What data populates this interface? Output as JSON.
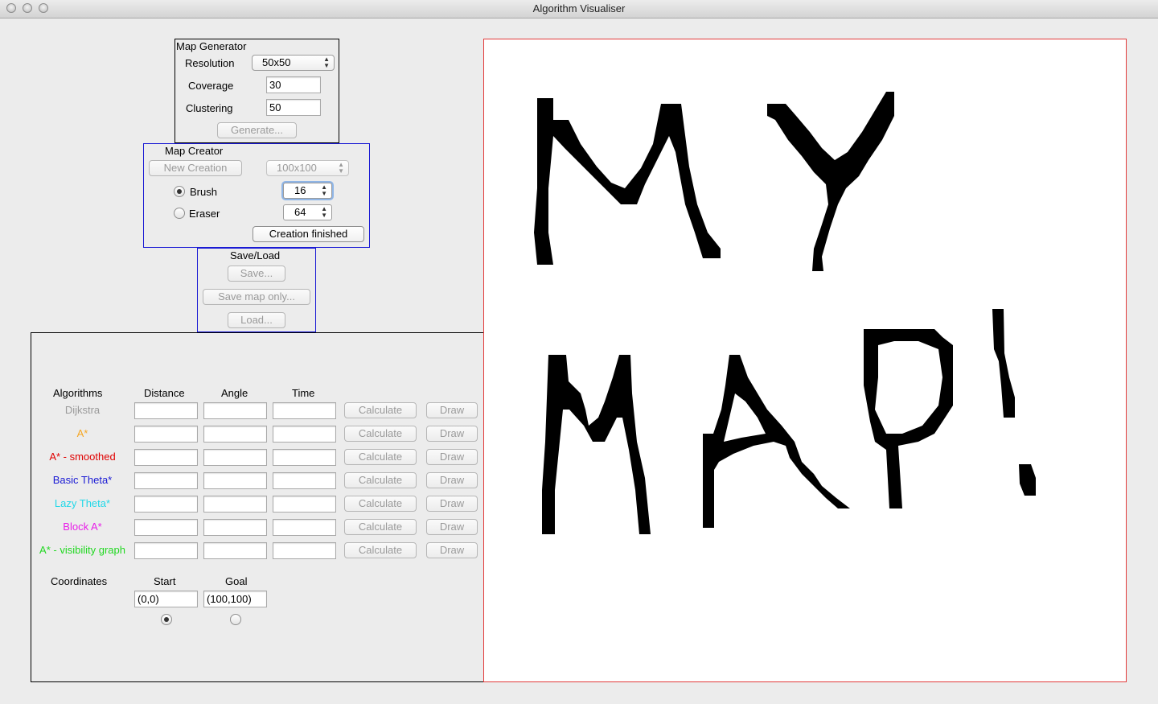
{
  "window": {
    "title": "Algorithm Visualiser"
  },
  "generator": {
    "title": "Map Generator",
    "resolution_label": "Resolution",
    "resolution_value": "50x50",
    "coverage_label": "Coverage",
    "coverage_value": "30",
    "clustering_label": "Clustering",
    "clustering_value": "50",
    "generate_label": "Generate..."
  },
  "creator": {
    "title": "Map Creator",
    "new_creation_label": "New Creation",
    "size_value": "100x100",
    "brush_label": "Brush",
    "brush_size": "16",
    "brush_selected": true,
    "eraser_label": "Eraser",
    "eraser_size": "64",
    "finished_label": "Creation finished"
  },
  "saveload": {
    "title": "Save/Load",
    "save_label": "Save...",
    "save_map_only_label": "Save map only...",
    "load_label": "Load..."
  },
  "algorithms": {
    "headers": {
      "algorithms": "Algorithms",
      "distance": "Distance",
      "angle": "Angle",
      "time": "Time"
    },
    "calculate_label": "Calculate",
    "draw_label": "Draw",
    "rows": [
      {
        "name": "Dijkstra",
        "color": "#9a9a9a"
      },
      {
        "name": "A*",
        "color": "#f5a623"
      },
      {
        "name": "A* - smoothed",
        "color": "#e00000"
      },
      {
        "name": "Basic Theta*",
        "color": "#1a1ad4"
      },
      {
        "name": "Lazy Theta*",
        "color": "#22d8e8"
      },
      {
        "name": "Block A*",
        "color": "#e81ce8"
      },
      {
        "name": "A* - visibility graph",
        "color": "#22d822"
      }
    ]
  },
  "coordinates": {
    "label": "Coordinates",
    "start_label": "Start",
    "goal_label": "Goal",
    "start_value": "(0,0)",
    "goal_value": "(100,100)",
    "start_selected": true
  },
  "map": {
    "border_color": "#e23a3a",
    "drawn_text": "MY MAP!"
  }
}
